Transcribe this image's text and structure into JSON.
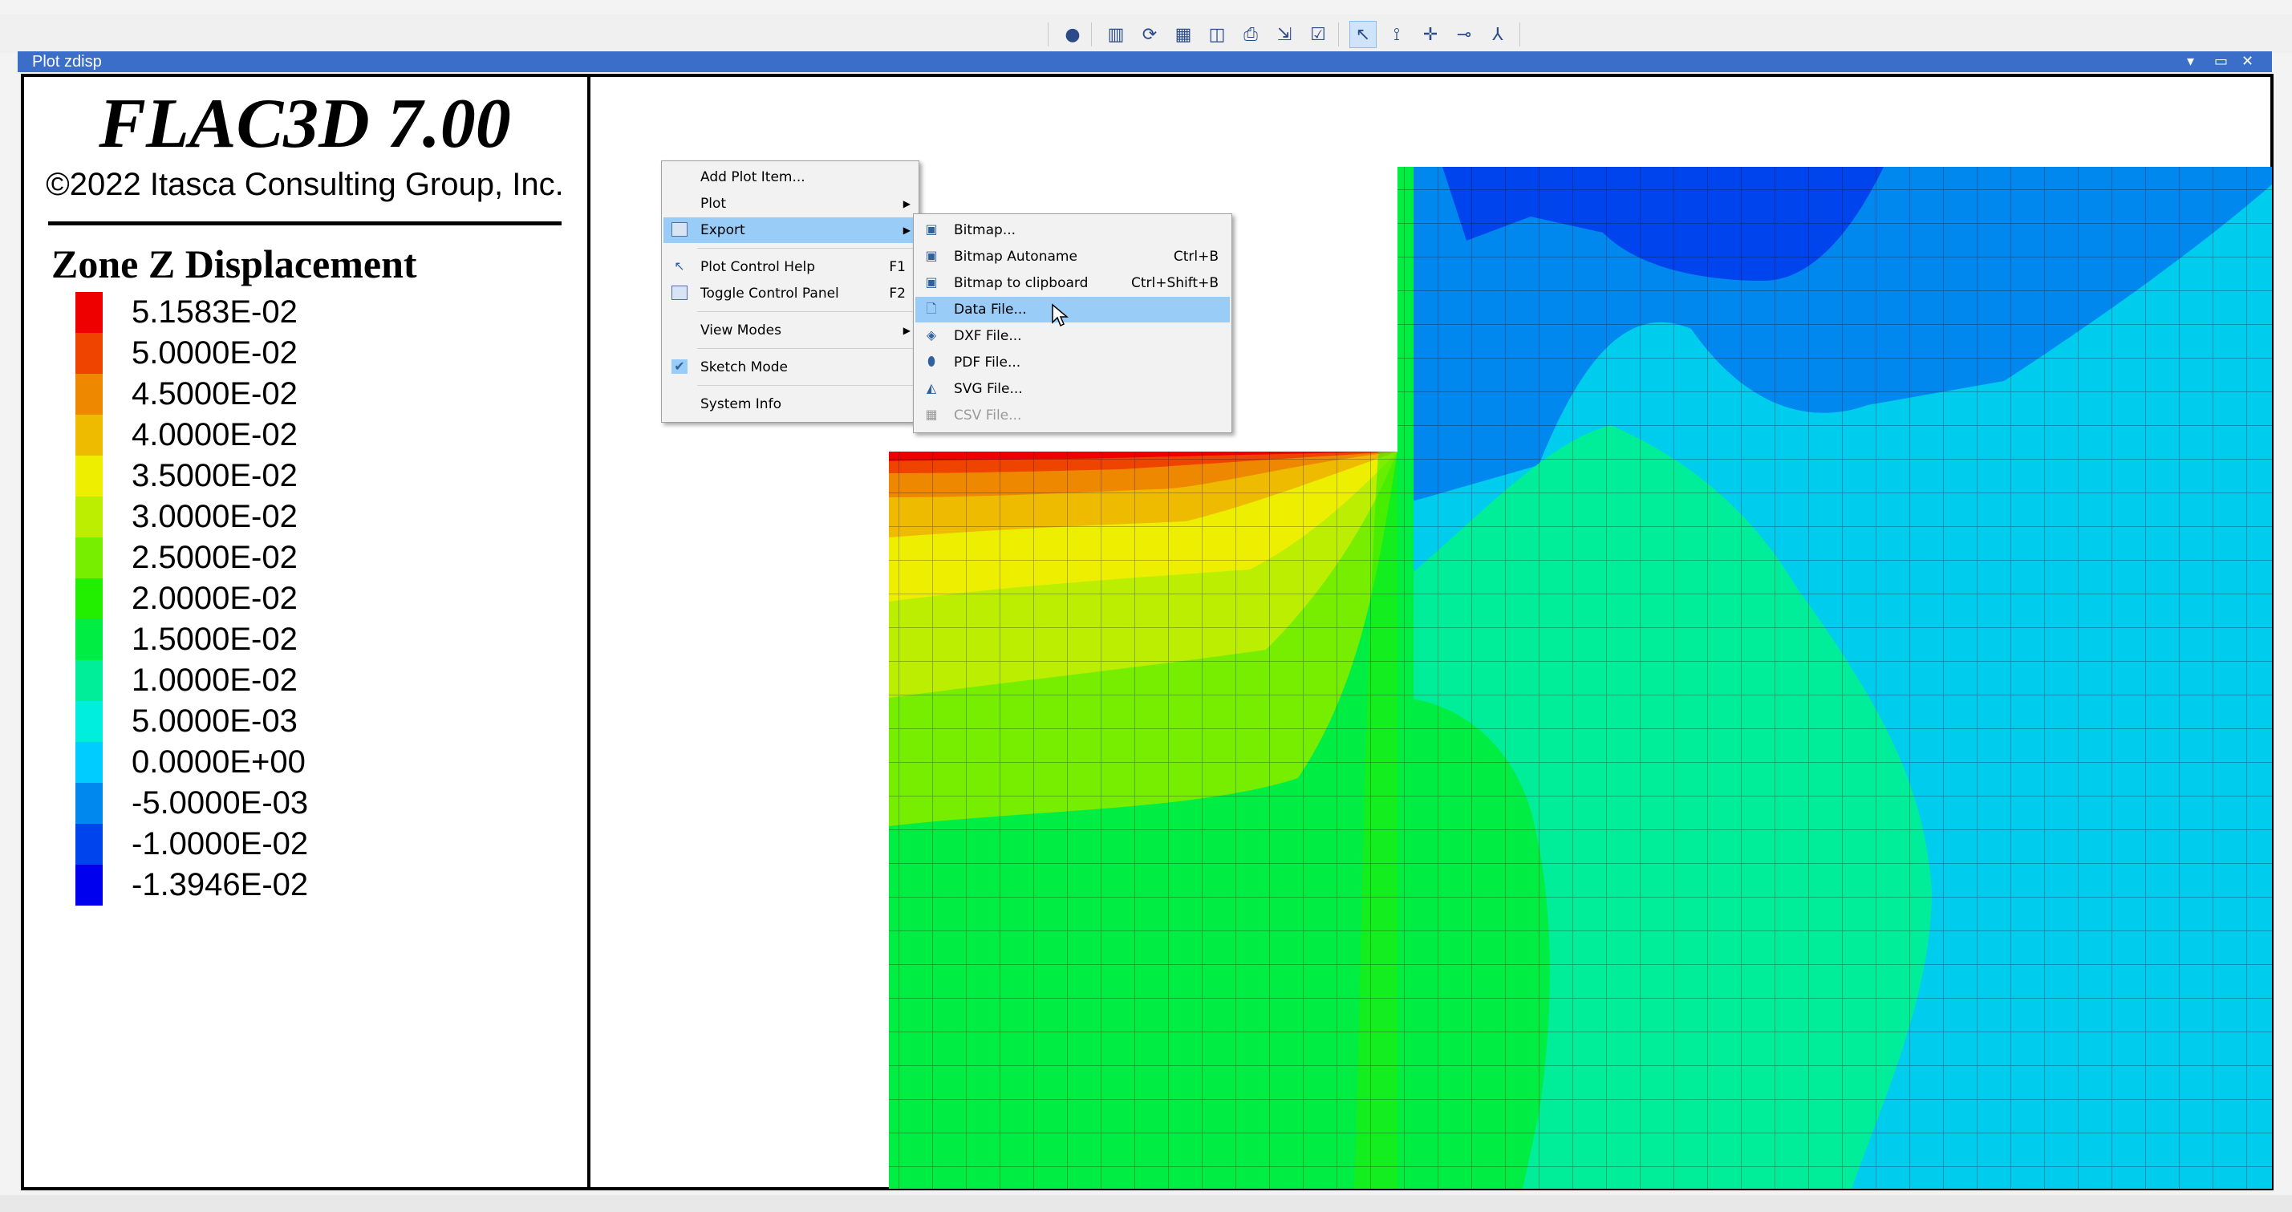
{
  "toolbar": {
    "buttons": [
      "record-icon",
      "panel-icon",
      "refresh-icon",
      "plot-item-icon",
      "split-icon",
      "print-icon",
      "export-icon",
      "check-icon",
      "select-cursor-icon",
      "pick-icon",
      "crosshair-icon",
      "measure-icon",
      "axes-icon"
    ],
    "active": "select-cursor-icon"
  },
  "window": {
    "title": "Plot zdisp",
    "controls": [
      "chevron-down-icon",
      "restore-icon",
      "close-icon"
    ]
  },
  "legend": {
    "app_title": "FLAC3D 7.00",
    "copyright": "©2022 Itasca Consulting Group, Inc.",
    "plot_title": "Zone Z Displacement",
    "values": [
      "5.1583E-02",
      "5.0000E-02",
      "4.5000E-02",
      "4.0000E-02",
      "3.5000E-02",
      "3.0000E-02",
      "2.5000E-02",
      "2.0000E-02",
      "1.5000E-02",
      "1.0000E-02",
      "5.0000E-03",
      "0.0000E+00",
      "-5.0000E-03",
      "-1.0000E-02",
      "-1.3946E-02"
    ],
    "colors": [
      "#ee0000",
      "#ee4400",
      "#ee8800",
      "#eebb00",
      "#eeee00",
      "#bbee00",
      "#77ee00",
      "#22ee00",
      "#00ee44",
      "#00ee99",
      "#00eedd",
      "#00ccff",
      "#0088ee",
      "#0044ee",
      "#0000ee"
    ]
  },
  "context_menu": {
    "items": [
      {
        "label": "Add Plot Item...",
        "shortcut": "",
        "submenu": false
      },
      {
        "label": "Plot",
        "shortcut": "",
        "submenu": true
      },
      {
        "label": "Export",
        "shortcut": "",
        "submenu": true
      },
      {
        "label": "Plot Control Help",
        "shortcut": "F1",
        "submenu": false
      },
      {
        "label": "Toggle Control Panel",
        "shortcut": "F2",
        "submenu": false
      },
      {
        "label": "View Modes",
        "shortcut": "",
        "submenu": true
      },
      {
        "label": "Sketch Mode",
        "shortcut": "",
        "submenu": false,
        "checked": true
      },
      {
        "label": "System Info",
        "shortcut": "",
        "submenu": false
      }
    ]
  },
  "export_menu": {
    "items": [
      {
        "label": "Bitmap...",
        "shortcut": "",
        "icon": "bitmap-icon"
      },
      {
        "label": "Bitmap Autoname",
        "shortcut": "Ctrl+B",
        "icon": "bitmap-icon"
      },
      {
        "label": "Bitmap to clipboard",
        "shortcut": "Ctrl+Shift+B",
        "icon": "bitmap-icon"
      },
      {
        "label": "Data File...",
        "shortcut": "",
        "icon": "document-icon"
      },
      {
        "label": "DXF File...",
        "shortcut": "",
        "icon": "dxf-icon"
      },
      {
        "label": "PDF File...",
        "shortcut": "",
        "icon": "pdf-icon"
      },
      {
        "label": "SVG File...",
        "shortcut": "",
        "icon": "svg-icon"
      },
      {
        "label": "CSV File...",
        "shortcut": "",
        "icon": "table-icon",
        "disabled": true
      }
    ]
  }
}
